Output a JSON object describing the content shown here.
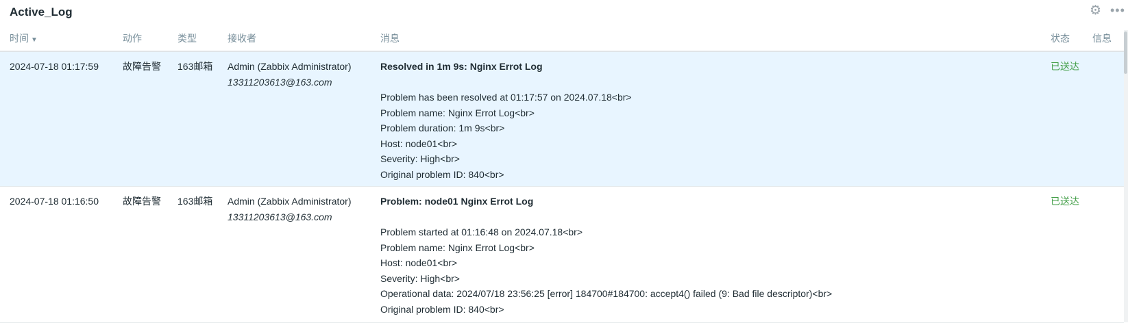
{
  "widget": {
    "title": "Active_Log",
    "gear_icon": "⚙",
    "menu_icon": "•••"
  },
  "columns": {
    "time": "时间",
    "action": "动作",
    "type": "类型",
    "recipient": "接收者",
    "message": "消息",
    "status": "状态",
    "info": "信息",
    "sort_indicator": "▼"
  },
  "rows": [
    {
      "time": "2024-07-18 01:17:59",
      "action": "故障告警",
      "type": "163邮箱",
      "recipient_name": "Admin (Zabbix Administrator)",
      "recipient_email": "13311203613@163.com",
      "subject": "Resolved in 1m 9s: Nginx Errot Log",
      "lines": [
        "Problem has been resolved at 01:17:57 on 2024.07.18<br>",
        "Problem name: Nginx Errot Log<br>",
        "Problem duration: 1m 9s<br>",
        "Host: node01<br>",
        "Severity: High<br>",
        "Original problem ID: 840<br>"
      ],
      "status": "已送达"
    },
    {
      "time": "2024-07-18 01:16:50",
      "action": "故障告警",
      "type": "163邮箱",
      "recipient_name": "Admin (Zabbix Administrator)",
      "recipient_email": "13311203613@163.com",
      "subject": "Problem: node01 Nginx Errot Log",
      "lines": [
        "Problem started at 01:16:48 on 2024.07.18<br>",
        "Problem name: Nginx Errot Log<br>",
        "Host: node01<br>",
        "Severity: High<br>",
        "Operational data: 2024/07/18 23:56:25 [error] 184700#184700: accept4() failed (9: Bad file descriptor)<br>",
        "Original problem ID: 840<br>"
      ],
      "status": "已送达"
    }
  ],
  "colors": {
    "status_sent": "#429e47",
    "row_highlight": "#e8f5ff",
    "header_text": "#768d99"
  }
}
